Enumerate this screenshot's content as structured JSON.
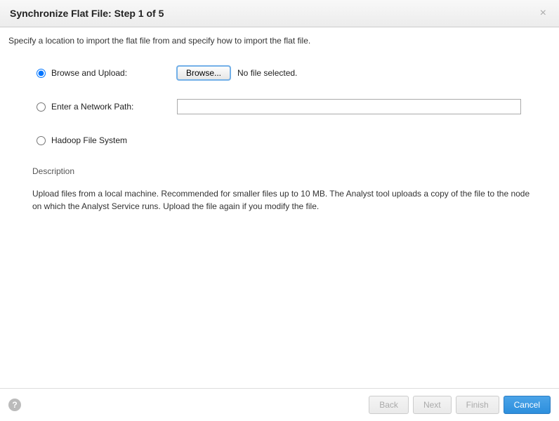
{
  "header": {
    "title": "Synchronize Flat File: Step 1 of 5"
  },
  "instruction": "Specify a location to import the flat file from and specify how to import the flat file.",
  "options": {
    "browse_upload": {
      "label": "Browse and Upload:",
      "selected": true
    },
    "network_path": {
      "label": "Enter a Network Path:",
      "selected": false,
      "value": ""
    },
    "hadoop": {
      "label": "Hadoop File System",
      "selected": false
    }
  },
  "browse": {
    "button_label": "Browse...",
    "file_status": "No file selected."
  },
  "description": {
    "heading": "Description",
    "body": "Upload files from a local machine. Recommended for smaller files up to 10 MB. The Analyst tool uploads a copy of the file to the node on which the Analyst Service runs. Upload the file again if you modify the file."
  },
  "footer": {
    "back": "Back",
    "next": "Next",
    "finish": "Finish",
    "cancel": "Cancel"
  }
}
